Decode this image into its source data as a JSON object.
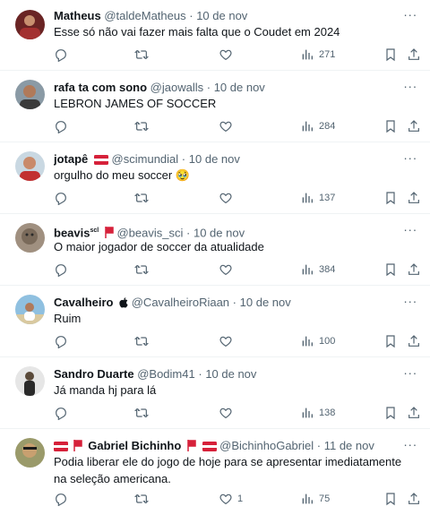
{
  "tweets": [
    {
      "name": "Matheus",
      "handle": "@taldeMatheus",
      "date": "10 de nov",
      "text": "Esse só não vai fazer mais falta que o Coudet em 2024",
      "replies": "",
      "retweets": "",
      "likes": "",
      "views": "271",
      "avatar_color": "#7a2d2d"
    },
    {
      "name": "rafa ta com sono",
      "handle": "@jaowalls",
      "date": "10 de nov",
      "text": "LEBRON JAMES OF SOCCER",
      "replies": "",
      "retweets": "",
      "likes": "",
      "views": "284",
      "avatar_color": "#6b5a4a"
    },
    {
      "name": "jotapê",
      "handle": "@scimundial",
      "date": "10 de nov",
      "text": "orgulho do meu soccer 🥹",
      "replies": "",
      "retweets": "",
      "likes": "",
      "views": "137",
      "avatar_color": "#b94a3a"
    },
    {
      "name": "beavis",
      "name_suffix": "scl",
      "handle": "@beavis_sci",
      "date": "10 de nov",
      "text": "O maior jogador de soccer da atualidade",
      "replies": "",
      "retweets": "",
      "likes": "",
      "views": "384",
      "avatar_color": "#8a7a6a"
    },
    {
      "name": "Cavalheiro",
      "handle": "@CavalheiroRiaan",
      "date": "10 de nov",
      "text": "Ruim",
      "replies": "",
      "retweets": "",
      "likes": "",
      "views": "100",
      "avatar_color": "#6aa0c8"
    },
    {
      "name": "Sandro Duarte",
      "handle": "@Bodim41",
      "date": "10 de nov",
      "text": "Já manda hj para lá",
      "replies": "",
      "retweets": "",
      "likes": "",
      "views": "138",
      "avatar_color": "#4a4a4a"
    },
    {
      "name": "Gabriel Bichinho",
      "handle": "@BichinhoGabriel",
      "date": "11 de nov",
      "text": "Podia liberar ele do jogo de hoje para se apresentar imediatamente na seleção americana.",
      "replies": "",
      "retweets": "",
      "likes": "1",
      "views": "75",
      "avatar_color": "#8a8a5a"
    }
  ],
  "separator": "·",
  "more_label": "···",
  "colors": {
    "text": "#0f1419",
    "muted": "#536471",
    "border": "#eff3f4",
    "flag_red": "#d6213a"
  },
  "icons": [
    "reply-icon",
    "retweet-icon",
    "like-icon",
    "views-icon",
    "bookmark-icon",
    "share-icon",
    "more-icon",
    "flag-icon",
    "apple-icon"
  ]
}
